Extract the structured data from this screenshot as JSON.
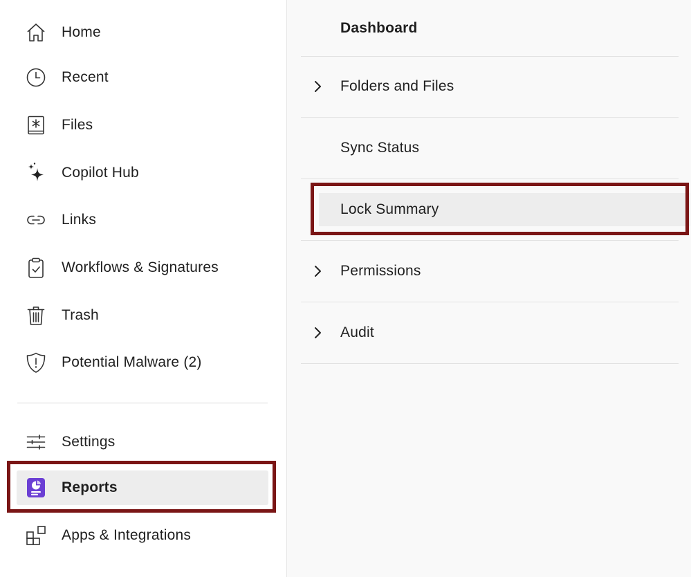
{
  "sidebar": {
    "items": [
      {
        "label": "Home",
        "icon": "home-icon"
      },
      {
        "label": "Recent",
        "icon": "clock-icon"
      },
      {
        "label": "Files",
        "icon": "files-icon"
      },
      {
        "label": "Copilot Hub",
        "icon": "sparkle-icon"
      },
      {
        "label": "Links",
        "icon": "link-icon"
      },
      {
        "label": "Workflows & Signatures",
        "icon": "clipboard-check-icon"
      },
      {
        "label": "Trash",
        "icon": "trash-icon"
      },
      {
        "label": "Potential Malware (2)",
        "icon": "shield-alert-icon"
      }
    ],
    "bottom_items": [
      {
        "label": "Settings",
        "icon": "sliders-icon"
      },
      {
        "label": "Reports",
        "icon": "reports-icon",
        "active": true
      },
      {
        "label": "Apps & Integrations",
        "icon": "apps-icon"
      }
    ]
  },
  "main": {
    "rows": [
      {
        "label": "Dashboard",
        "expandable": false,
        "header": true
      },
      {
        "label": "Folders and Files",
        "expandable": true
      },
      {
        "label": "Sync Status",
        "expandable": false
      },
      {
        "label": "Lock Summary",
        "expandable": false,
        "selected": true
      },
      {
        "label": "Permissions",
        "expandable": true
      },
      {
        "label": "Audit",
        "expandable": true
      }
    ]
  },
  "colors": {
    "highlight_border": "#7a1515",
    "reports_icon": "#6b3fd4",
    "active_bg": "#ededed",
    "panel_bg": "#f9f9f9"
  }
}
